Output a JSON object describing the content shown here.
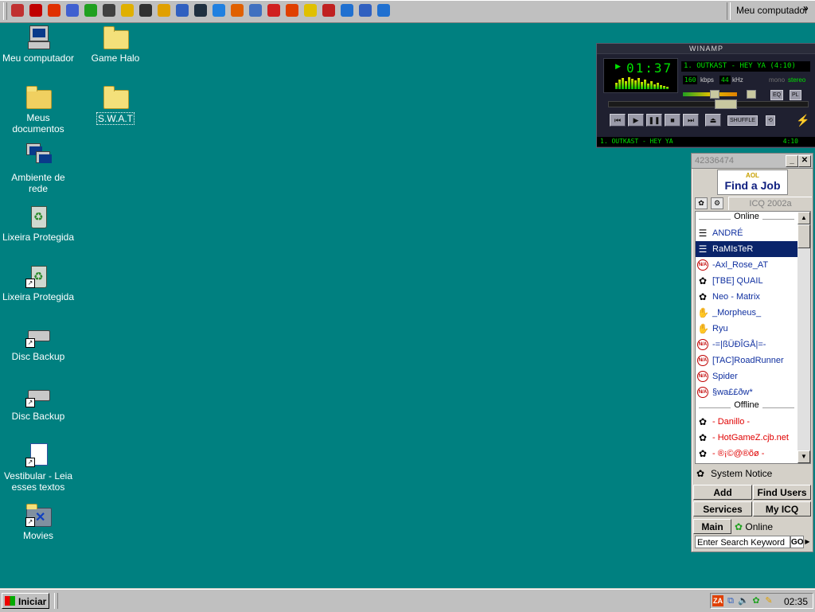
{
  "toolbar": {
    "quick_launch": [
      {
        "name": "mail-icon",
        "color": "#c03030"
      },
      {
        "name": "cd-player-icon",
        "color": "#c00000"
      },
      {
        "name": "media-icon",
        "color": "#e03000"
      },
      {
        "name": "paint-icon",
        "color": "#4060d0"
      },
      {
        "name": "clover-icon",
        "color": "#20a020"
      },
      {
        "name": "move-icon",
        "color": "#404040"
      },
      {
        "name": "chat-icon",
        "color": "#e0b000"
      },
      {
        "name": "film-icon",
        "color": "#303030"
      },
      {
        "name": "pencil-icon",
        "color": "#e0a000"
      },
      {
        "name": "info-icon",
        "color": "#3060c0"
      },
      {
        "name": "terminal-icon",
        "color": "#203040"
      },
      {
        "name": "globe-icon",
        "color": "#2080e0"
      },
      {
        "name": "diamond-icon",
        "color": "#e06000"
      },
      {
        "name": "image-icon",
        "color": "#4070c0"
      },
      {
        "name": "stop-icon",
        "color": "#d02020"
      },
      {
        "name": "zonealarm-icon",
        "color": "#e04000"
      },
      {
        "name": "lightning-icon",
        "color": "#e0c000"
      },
      {
        "name": "cursor-icon",
        "color": "#c02020"
      },
      {
        "name": "ie-icon",
        "color": "#2070d0"
      },
      {
        "name": "outlook-icon",
        "color": "#3060c0"
      },
      {
        "name": "ie2-icon",
        "color": "#2070d0"
      }
    ],
    "my_computer_label": "Meu computador",
    "chevron": "»"
  },
  "desktop": {
    "icons": [
      {
        "label": "Meu computador",
        "type": "computer"
      },
      {
        "label": "Game  Halo",
        "type": "folder"
      },
      {
        "label": "Meus documentos",
        "type": "docs"
      },
      {
        "label": "S.W.A.T",
        "type": "folder"
      },
      {
        "label": "Ambiente de rede",
        "type": "network"
      },
      {
        "label": "Lixeira Protegida",
        "type": "bin"
      },
      {
        "label": "Lixeira Protegida",
        "type": "bin"
      },
      {
        "label": "Disc Backup",
        "type": "drive"
      },
      {
        "label": "Disc Backup",
        "type": "drive"
      },
      {
        "label": "Vestibular - Leia esses textos",
        "type": "doc"
      },
      {
        "label": "Movies",
        "type": "movies"
      }
    ]
  },
  "winamp": {
    "title": "WINAMP",
    "time": "01:37",
    "song": "1. OUTKAST - HEY YA (4:10)",
    "kbps": "160",
    "kbps_label": "kbps",
    "khz": "44",
    "khz_label": "kHz",
    "mono": "mono",
    "stereo": "stereo",
    "eq": "EQ",
    "pl": "PL",
    "shuffle": "SHUFFLE",
    "ticker_song": "1. OUTKAST - HEY YA",
    "ticker_time": "4:10",
    "colors": {
      "display": "#00e000"
    }
  },
  "icq": {
    "uin": "42336474",
    "ad_brand": "AOL",
    "ad_text": "Find a Job",
    "version": "ICQ 2002a",
    "groups": {
      "online": "Online",
      "offline": "Offline"
    },
    "online_contacts": [
      {
        "name": "ANDRÉ",
        "icon": "user-icon"
      },
      {
        "name": "RaMIsTeR",
        "icon": "user-icon",
        "selected": true
      },
      {
        "name": "-Axl_Rose_AT",
        "icon": "na-icon"
      },
      {
        "name": "[TBE] QUAIL",
        "icon": "flower-icon"
      },
      {
        "name": "Neo - Matrix",
        "icon": "flower-icon"
      },
      {
        "name": "_Morpheus_",
        "icon": "away-icon"
      },
      {
        "name": "Ryu",
        "icon": "away-icon"
      },
      {
        "name": "-=|ßÜÐÎGÅ|=-",
        "icon": "na-icon"
      },
      {
        "name": "[TAC]RoadRunner",
        "icon": "na-icon"
      },
      {
        "name": "Spider",
        "icon": "na-icon"
      },
      {
        "name": "§wa££ðw*",
        "icon": "na-icon"
      }
    ],
    "offline_contacts": [
      {
        "name": "- Danillo -",
        "icon": "flower-icon"
      },
      {
        "name": "- HotGameZ.cjb.net",
        "icon": "flower-icon"
      },
      {
        "name": "- ®¡©@®õø -",
        "icon": "flower-icon"
      }
    ],
    "system_notice": "System Notice",
    "buttons": {
      "add": "Add",
      "find_users": "Find Users",
      "services": "Services",
      "my_icq": "My ICQ",
      "main": "Main"
    },
    "status": "Online",
    "search_placeholder": "Enter Search Keyword",
    "go": "GO!",
    "colors": {
      "online_text": "#1030a0",
      "offline_text": "#e00000",
      "selected_bg": "#0a246a"
    }
  },
  "taskbar": {
    "start_label": "Iniciar",
    "clock": "02:35",
    "tray_icons": [
      "zonealarm-icon",
      "network-icon",
      "volume-icon",
      "icq-flower-icon",
      "pencil-icon"
    ]
  }
}
